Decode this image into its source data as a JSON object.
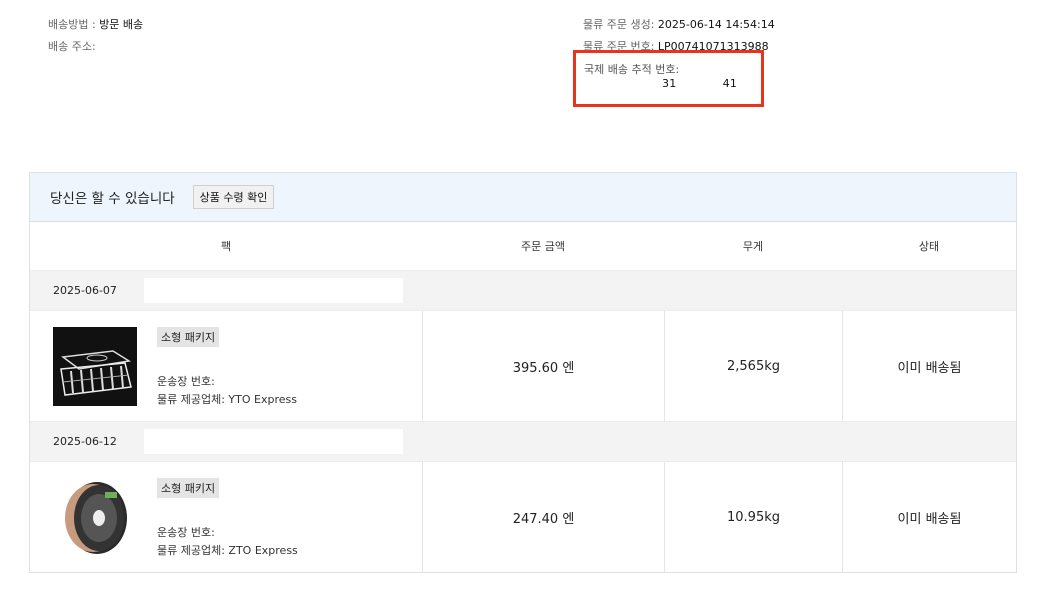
{
  "shipping": {
    "method_label": "배송방법 :",
    "method_value": "방문 배송",
    "address_label": "배송 주소:"
  },
  "logistics": {
    "created_label": "물류 주문 생성:",
    "created_value": "2025-06-14 14:54:14",
    "order_no_label": "물류 주문 번호:",
    "order_no_value": "LP00741071313988",
    "tracking_label": "국제 배송 추적 번호:",
    "tracking_start": "31",
    "tracking_end": "41"
  },
  "actions": {
    "prompt": "당신은 할 수 있습니다",
    "confirm_button": "상품 수령 확인"
  },
  "table": {
    "headers": [
      "팩",
      "주문 금액",
      "무게",
      "상태"
    ],
    "groups": [
      {
        "date": "2025-06-07",
        "package_type": "소형 패키지",
        "waybill_label": "운송장 번호:",
        "carrier_text": "물류 제공업체: YTO Express",
        "amount": "395.60 엔",
        "weight": "2,565kg",
        "status": "이미 배송됨",
        "thumbnail": "acrylic-organizer-image"
      },
      {
        "date": "2025-06-12",
        "package_type": "소형 패키지",
        "waybill_label": "운송장 번호:",
        "carrier_text": "물류 제공업체: ZTO Express",
        "amount": "247.40 엔",
        "weight": "10.95kg",
        "status": "이미 배송됨",
        "thumbnail": "filament-spool-image"
      }
    ]
  },
  "colors": {
    "highlight_border": "#e8341c",
    "action_bar_bg": "#eef5fd",
    "date_row_bg": "#f3f3f3"
  }
}
